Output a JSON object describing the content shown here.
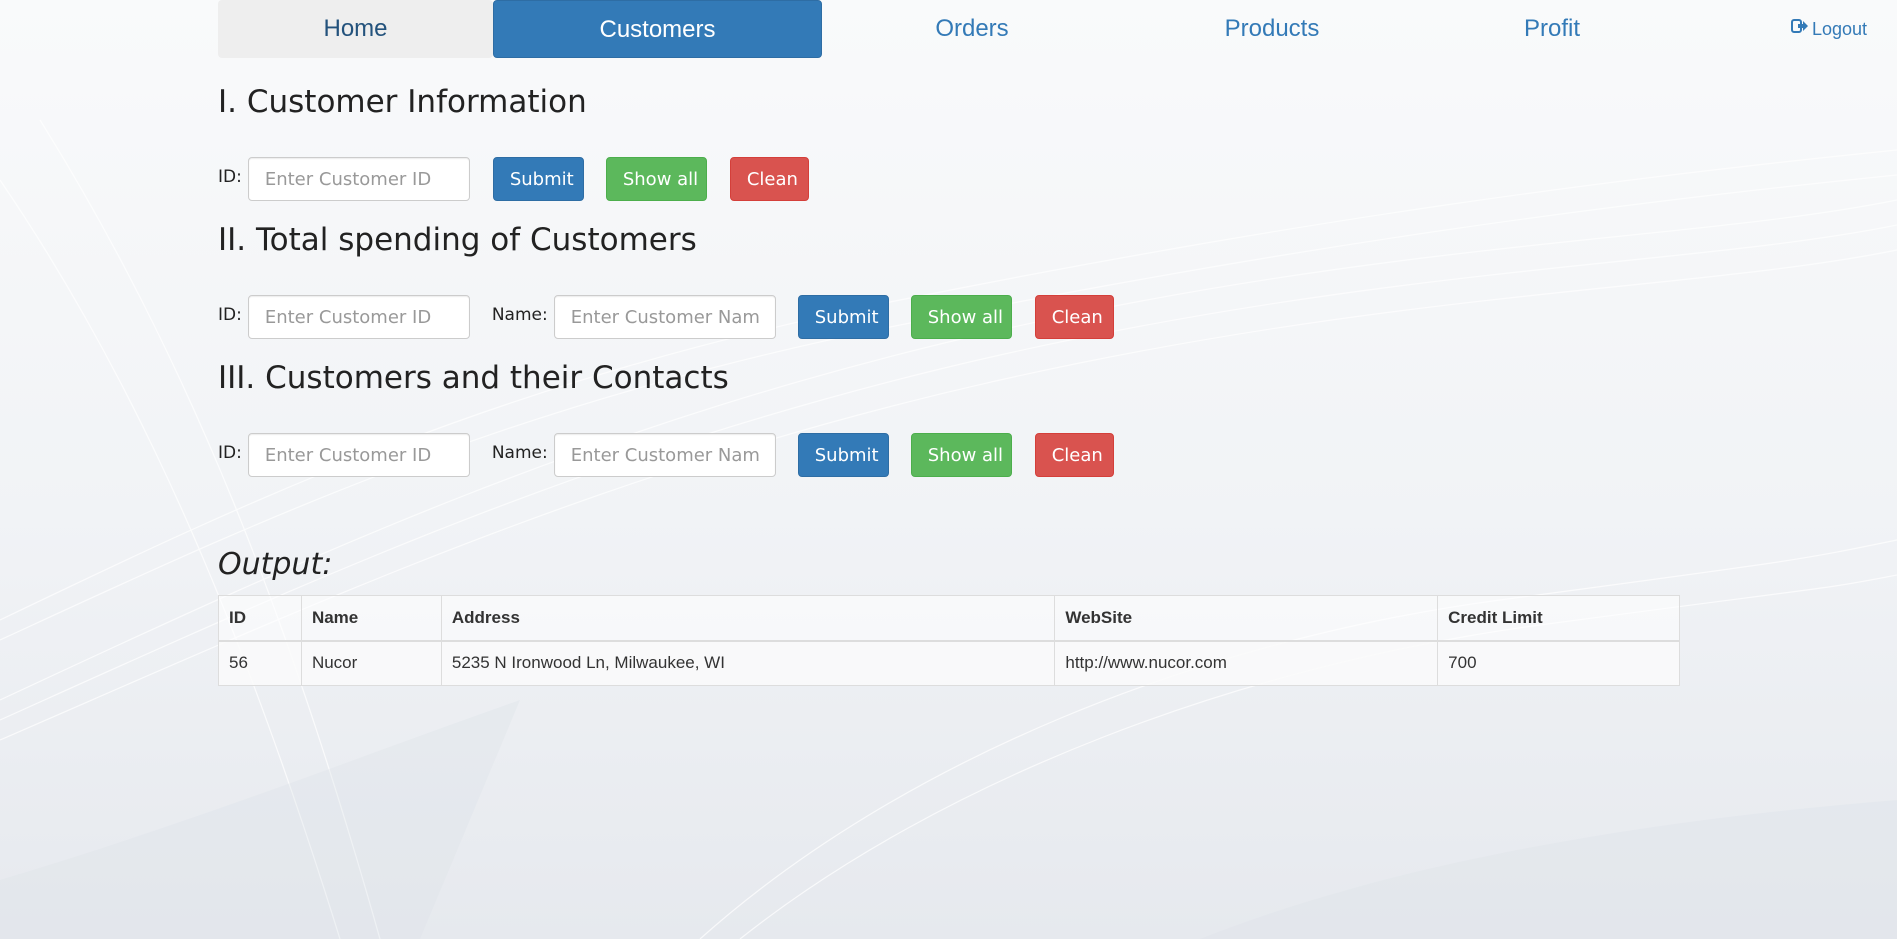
{
  "nav": {
    "items": [
      {
        "label": "Home",
        "active": false
      },
      {
        "label": "Customers",
        "active": true
      },
      {
        "label": "Orders",
        "active": false
      },
      {
        "label": "Products",
        "active": false
      },
      {
        "label": "Profit",
        "active": false
      }
    ],
    "logout_label": "Logout",
    "logout_icon": "logout-icon"
  },
  "sections": [
    {
      "title": "I. Customer Information",
      "id_label": "ID:",
      "id_placeholder": "Enter Customer ID",
      "submit": "Submit",
      "show_all": "Show all",
      "clean": "Clean"
    },
    {
      "title": "II. Total spending of Customers",
      "id_label": "ID:",
      "id_placeholder": "Enter Customer ID",
      "name_label": "Name:",
      "name_placeholder": "Enter Customer Name",
      "submit": "Submit",
      "show_all": "Show all",
      "clean": "Clean"
    },
    {
      "title": "III. Customers and their Contacts",
      "id_label": "ID:",
      "id_placeholder": "Enter Customer ID",
      "name_label": "Name:",
      "name_placeholder": "Enter Customer Name",
      "submit": "Submit",
      "show_all": "Show all",
      "clean": "Clean"
    }
  ],
  "output": {
    "title": "Output:",
    "columns": [
      "ID",
      "Name",
      "Address",
      "WebSite",
      "Credit Limit"
    ],
    "rows": [
      [
        "56",
        "Nucor",
        "5235 N Ironwood Ln, Milwaukee, WI",
        "http://www.nucor.com",
        "700"
      ]
    ]
  },
  "colors": {
    "primary": "#337ab7",
    "success": "#5cb85c",
    "danger": "#d9534f",
    "nav_inactive_bg": "#eeeeee"
  }
}
